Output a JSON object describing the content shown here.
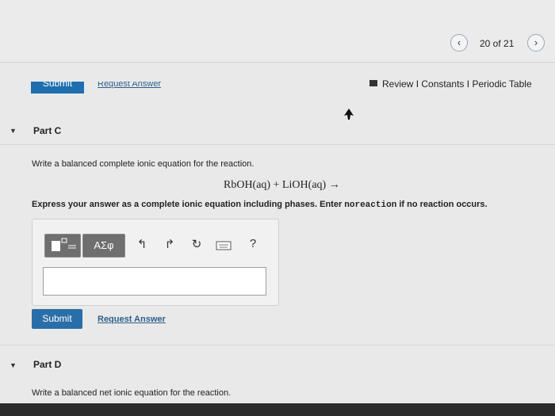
{
  "pager": {
    "prev_icon": "chevron-left",
    "label": "20 of 21",
    "next_icon": "chevron-right"
  },
  "top_actions": {
    "submit_label": "Submit",
    "request_label": "Request Answer"
  },
  "header_links": {
    "review": "Review",
    "sep1": "I",
    "constants": "Constants",
    "sep2": "I",
    "periodic": "Periodic Table"
  },
  "part_c": {
    "title": "Part C",
    "prompt": "Write a balanced complete ionic equation for the reaction.",
    "equation": "RbOH(aq) + LiOH(aq) →",
    "instruction_before": "Express your answer as a complete ionic equation including phases. Enter ",
    "instruction_code": "noreaction",
    "instruction_after": " if no reaction occurs.",
    "toolbar": {
      "greek_label": "ΑΣφ",
      "help_label": "?"
    },
    "answer_value": "",
    "submit_label": "Submit",
    "request_label": "Request Answer"
  },
  "part_d": {
    "title": "Part D",
    "prompt": "Write a balanced net ionic equation for the reaction."
  }
}
